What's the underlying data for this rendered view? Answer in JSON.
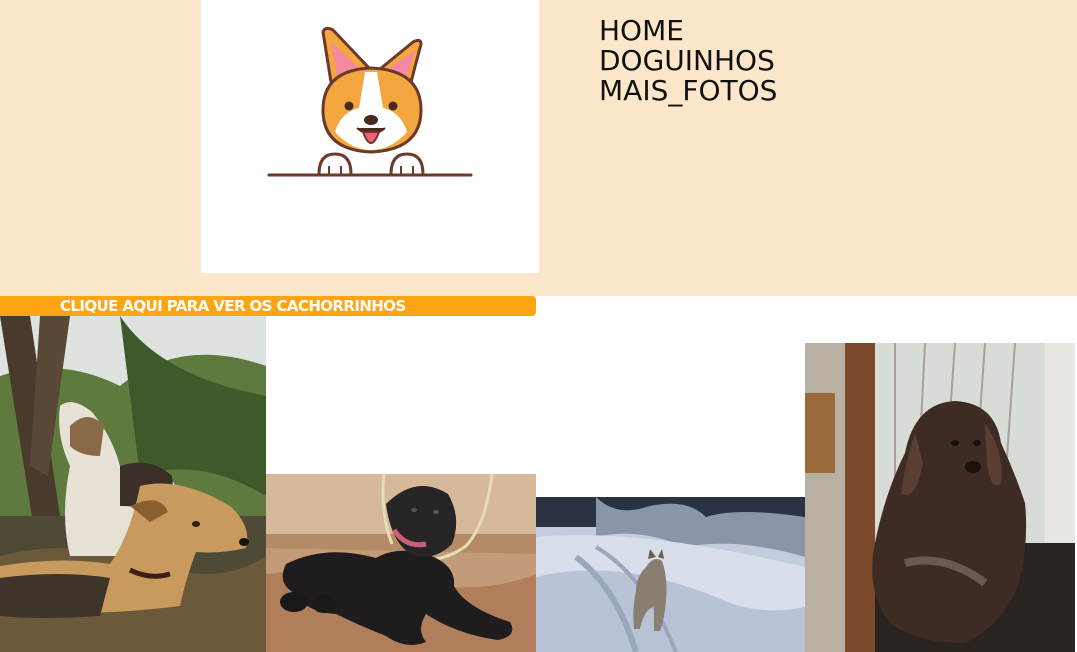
{
  "nav": {
    "items": [
      {
        "label": "HOME"
      },
      {
        "label": "DOGUINHOS"
      },
      {
        "label": "MAIS_FOTOS"
      }
    ]
  },
  "cta": {
    "label": "CLIQUE AQUI PARA VER OS CACHORRINHOS"
  },
  "logo": {
    "icon": "corgi-logo-icon"
  },
  "gallery": {
    "photos": [
      {
        "subject": "fox-terriers-in-forest"
      },
      {
        "subject": "black-puppy-lying-on-ground"
      },
      {
        "subject": "dog-in-snow"
      },
      {
        "subject": "brown-dog-by-door"
      }
    ]
  },
  "colors": {
    "header_bg": "#fce7cb",
    "cta_bg": "#ffa412",
    "cta_text": "#ffffff",
    "nav_text": "#111111"
  }
}
